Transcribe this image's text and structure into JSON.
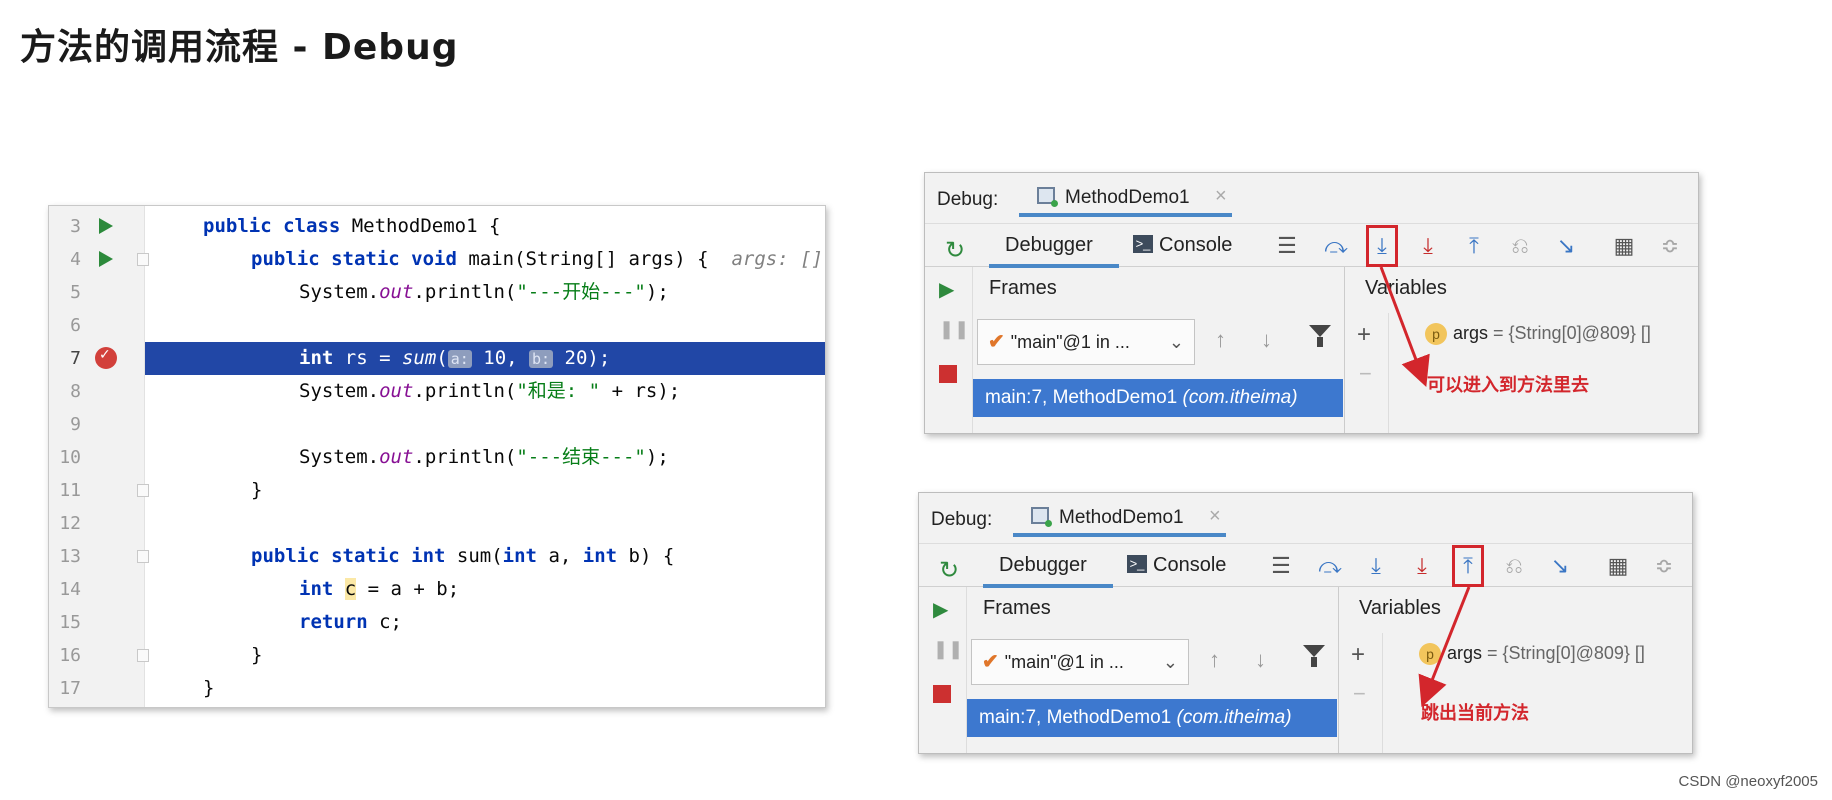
{
  "slide_title": "方法的调用流程  -  Debug",
  "watermark": "CSDN @neoxyf2005",
  "editor": {
    "lines": [
      {
        "num": "3"
      },
      {
        "num": "4"
      },
      {
        "num": "5"
      },
      {
        "num": "6"
      },
      {
        "num": "7"
      },
      {
        "num": "8"
      },
      {
        "num": "9"
      },
      {
        "num": "10"
      },
      {
        "num": "11"
      },
      {
        "num": "12"
      },
      {
        "num": "13"
      },
      {
        "num": "14"
      },
      {
        "num": "15"
      },
      {
        "num": "16"
      },
      {
        "num": "17"
      }
    ],
    "code": {
      "l3_kw": "public class",
      "l3_rest": " MethodDemo1 {",
      "l4_kw": "public static void",
      "l4_rest": " main(String[] args) {",
      "l4_hint": "args: []",
      "l5_pre": "System.",
      "l5_out": "out",
      "l5_mid": ".println(",
      "l5_str": "\"---开始---\"",
      "l5_end": ");",
      "l7_kw": "int",
      "l7_mid": " rs = ",
      "l7_sum": "sum",
      "l7_paren": "(",
      "l7_hint_a": "a:",
      "l7_a": " 10, ",
      "l7_hint_b": "b:",
      "l7_b": " 20);",
      "l8_pre": "System.",
      "l8_out": "out",
      "l8_mid": ".println(",
      "l8_str": "\"和是: \"",
      "l8_end": " + rs);",
      "l10_pre": "System.",
      "l10_out": "out",
      "l10_mid": ".println(",
      "l10_str": "\"---结束---\"",
      "l10_end": ");",
      "l11": "}",
      "l13_kw": "public static int",
      "l13_mid": " sum(",
      "l13_kw2": "int",
      "l13_a": " a, ",
      "l13_kw3": "int",
      "l13_b": " b) {",
      "l14_kw": "int",
      "l14_c": "c",
      "l14_rest": " = a + b;",
      "l15_kw": "return",
      "l15_rest": " c;",
      "l16": "}",
      "l17": "}"
    }
  },
  "debug_panels": [
    {
      "label": "Debug:",
      "session": "MethodDemo1",
      "close": "×",
      "tabs": {
        "debugger": "Debugger",
        "console": "Console"
      },
      "frames_label": "Frames",
      "variables_label": "Variables",
      "thread": "\"main\"@1 in ...",
      "frame": "main:7, MethodDemo1",
      "frame_pkg": "(com.itheima)",
      "var_name": "args",
      "var_value": " = {String[0]@809} []",
      "annotation": "可以进入到方法里去",
      "highlighted_action": "step-into"
    },
    {
      "label": "Debug:",
      "session": "MethodDemo1",
      "close": "×",
      "tabs": {
        "debugger": "Debugger",
        "console": "Console"
      },
      "frames_label": "Frames",
      "variables_label": "Variables",
      "thread": "\"main\"@1 in ...",
      "frame": "main:7, MethodDemo1",
      "frame_pkg": "(com.itheima)",
      "var_name": "args",
      "var_value": " = {String[0]@809} []",
      "annotation": "跳出当前方法",
      "highlighted_action": "step-out"
    }
  ],
  "icons": {
    "rerun": "↻",
    "menu": "☰",
    "step_over": "⤼",
    "step_into": "⤓",
    "force_step_into": "⤓",
    "step_out": "⤒",
    "drop_frame": "⎌",
    "run_to_cursor": "↘",
    "evaluate": "▦",
    "settings": "≎",
    "resume": "▶",
    "pause": "❚❚",
    "up": "↑",
    "down": "↓",
    "plus": "+",
    "minus": "−",
    "chevron": "⌄",
    "check": "✔",
    "param": "p",
    "console": ">_"
  },
  "colors": {
    "selection": "#2147a6",
    "frame_selected": "#3d78cf",
    "annotation_red": "#d3262c",
    "tab_underline": "#4a88c7"
  }
}
